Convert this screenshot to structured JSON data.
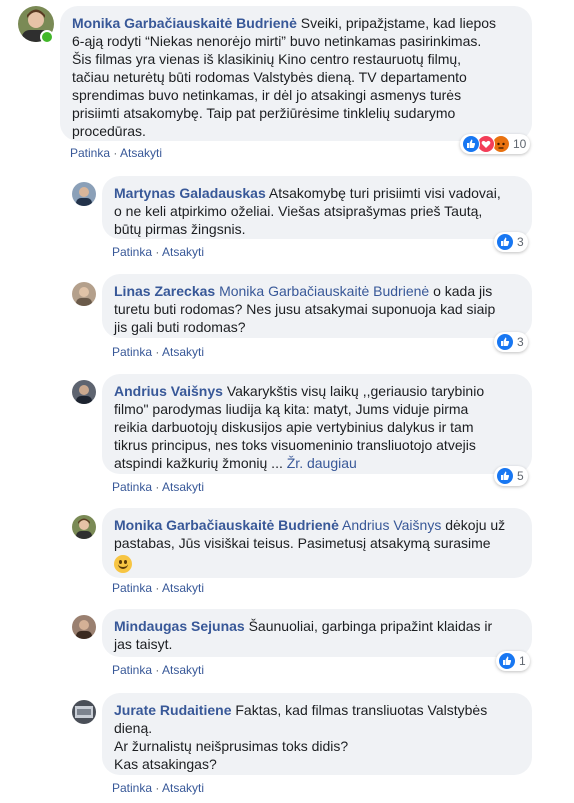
{
  "comments": [
    {
      "author": "Monika Garbačiauskaitė Budrienė",
      "lines": [
        "Sveiki, pripažįstame, kad liepos",
        "6-ąją rodyti “Niekas nenorėjo mirti” buvo netinkamas pasirinkimas.",
        "Šis filmas yra vienas iš klasikinių Kino centro restauruotų filmų,",
        "tačiau neturėtų būti rodomas Valstybės dieną. TV departamento",
        "sprendimas buvo netinkamas, ir dėl jo atsakingi asmenys turės",
        "prisiimti atsakomybę. Taip pat peržiūrėsime tinklelių sudarymo",
        "procedūras."
      ],
      "like": "Patinka",
      "reply": "Atsakyti",
      "reactions": 10
    },
    {
      "author": "Martynas Galadauskas",
      "lines": [
        "Atsakomybę turi prisiimti visi vadovai,",
        "o ne keli atpirkimo oželiai. Viešas atsiprašymas prieš Tautą,",
        "būtų pirmas žingsnis."
      ],
      "like": "Patinka",
      "reply": "Atsakyti",
      "reactions": 3
    },
    {
      "author": "Linas Zareckas",
      "mention": "Monika Garbačiauskaitė Budrienė",
      "lines": [
        "o kada jis",
        "turetu buti rodomas? Nes jusu atsakymai suponuoja kad siaip",
        "jis gali buti rodomas?"
      ],
      "like": "Patinka",
      "reply": "Atsakyti",
      "reactions": 3
    },
    {
      "author": "Andrius Vaišnys",
      "lines": [
        "Vakarykštis visų laikų ,,geriausio tarybinio",
        "filmo\" parodymas liudija ką kita: matyt, Jums viduje pirma",
        "reikia darbuotojų diskusijos apie vertybinius dalykus ir tam",
        "tikrus principus, nes toks visuomeninio transliuotojo atvejis",
        "atspindi kažkurių žmonių ..."
      ],
      "see_more": "Žr. daugiau",
      "like": "Patinka",
      "reply": "Atsakyti",
      "reactions": 5
    },
    {
      "author": "Monika Garbačiauskaitė Budrienė",
      "mention": "Andrius Vaišnys",
      "lines": [
        "dėkoju už",
        "pastabas, Jūs visiškai teisus. Pasimetusį atsakymą surasime"
      ],
      "like": "Patinka",
      "reply": "Atsakyti"
    },
    {
      "author": "Mindaugas Sejunas",
      "lines": [
        "Šaunuoliai, garbinga pripažint klaidas ir",
        "jas taisyt."
      ],
      "like": "Patinka",
      "reply": "Atsakyti",
      "reactions": 1
    },
    {
      "author": "Jurate Rudaitiene",
      "lines": [
        "Faktas, kad filmas transliuotas Valstybės",
        "dieną.",
        "Ar žurnalistų neišprusimas toks didis?",
        "Kas atsakingas?"
      ],
      "like": "Patinka",
      "reply": "Atsakyti"
    }
  ],
  "separator": " · ",
  "colors": {
    "link": "#385898",
    "bubble": "#f0f2f5",
    "like_blue": "#1877f2",
    "love_red": "#f33e58",
    "angry_orange": "#e9710f",
    "online_green": "#42b72a"
  },
  "icons": [
    "like-icon",
    "love-icon",
    "angry-icon",
    "smile-emoji-icon"
  ]
}
